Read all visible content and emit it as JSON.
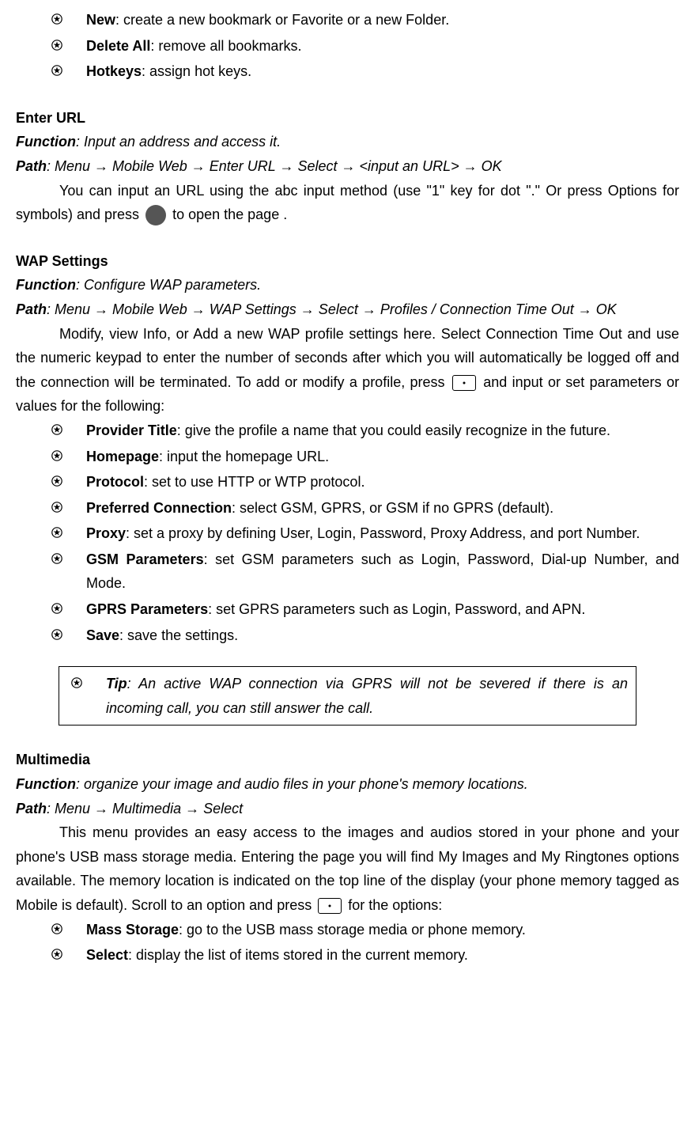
{
  "top_bullets": [
    {
      "term": "New",
      "desc": ": create a new bookmark or Favorite or a new Folder."
    },
    {
      "term": "Delete All",
      "desc": ": remove all bookmarks."
    },
    {
      "term": "Hotkeys",
      "desc": ": assign hot keys."
    }
  ],
  "enter_url": {
    "heading": "Enter URL",
    "func_label": "Function",
    "func_text": ": Input an address and access it.",
    "path_label": "Path",
    "path_text": ": Menu → Mobile Web → Enter URL → Select → <input an URL> → OK",
    "body1": "You can input an URL using the abc input method (use \"1\" key for dot \".\" Or press Options for symbols) and press ",
    "body2": " to open the page ."
  },
  "wap": {
    "heading": "WAP Settings",
    "func_label": "Function",
    "func_text": ": Configure WAP parameters.",
    "path_label": "Path",
    "path_text": ": Menu → Mobile Web → WAP Settings → Select → Profiles / Connection Time Out → OK",
    "body1": "Modify, view Info, or Add a new WAP profile settings here. Select Connection Time Out and use the numeric keypad to enter the number of seconds after which you will automatically be logged off and the connection will be terminated. To add or modify a profile, press ",
    "body2": " and input or set parameters or values for the following:",
    "bullets": [
      {
        "term": "Provider Title",
        "desc": ": give the profile a name that you could easily recognize in the future."
      },
      {
        "term": "Homepage",
        "desc": ": input the homepage URL."
      },
      {
        "term": "Protocol",
        "desc": ": set to use HTTP or WTP protocol."
      },
      {
        "term": "Preferred Connection",
        "desc": ": select GSM, GPRS, or GSM if no GPRS (default)."
      },
      {
        "term": "Proxy",
        "desc": ": set a proxy by defining User, Login, Password, Proxy Address, and port Number."
      },
      {
        "term": "GSM Parameters",
        "desc": ": set GSM parameters such as Login, Password, Dial-up Number, and Mode."
      },
      {
        "term": "GPRS Parameters",
        "desc": ": set GPRS parameters such as Login, Password, and APN."
      },
      {
        "term": "Save",
        "desc": ": save the settings."
      }
    ],
    "tip_label": "Tip",
    "tip_text": ": An active WAP connection via GPRS will not be severed if there is an incoming call, you can still answer the call."
  },
  "multimedia": {
    "heading": "Multimedia",
    "func_label": "Function",
    "func_text": ": organize your image and audio files in your phone's memory locations.",
    "path_label": "Path",
    "path_text": ": Menu → Multimedia → Select",
    "body1": "This menu provides an easy access to the images and audios stored in your phone and your phone's USB mass storage media. Entering the page you will find My Images and My Ringtones options available. The memory location is indicated on the top line of the display (your phone memory tagged as Mobile is default). Scroll to an option and press ",
    "body2": " for the options:",
    "bullets": [
      {
        "term": "Mass Storage",
        "desc": ": go to the USB mass storage media or phone memory."
      },
      {
        "term": "Select",
        "desc": ": display the list of items stored in the current memory."
      }
    ]
  },
  "ok_label": "OK"
}
